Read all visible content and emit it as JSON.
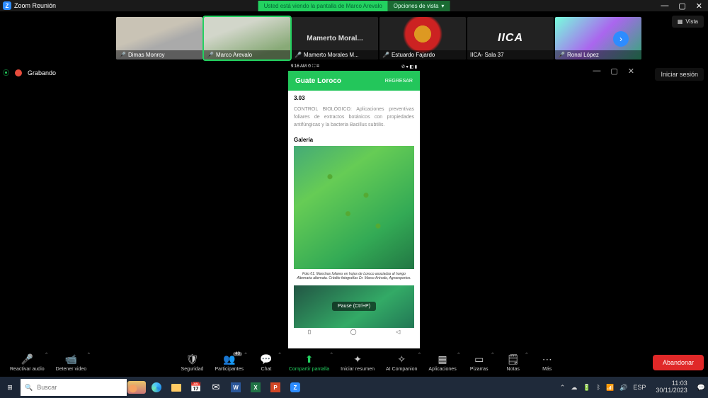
{
  "window": {
    "title": "Zoom Reunión"
  },
  "share_banner": {
    "message": "Usted está viendo la pantalla de Marco Arevalo",
    "options_label": "Opciones de vista"
  },
  "view_button": "Vista",
  "participants_strip": [
    {
      "name": "Dimas Monroy",
      "muted": true,
      "type": "cam",
      "cam": "c1"
    },
    {
      "name": "Marco Arevalo",
      "muted": true,
      "type": "cam",
      "cam": "c2",
      "speaking": true
    },
    {
      "name": "Mamerto Morales M...",
      "muted": true,
      "type": "placeholder",
      "placeholder_text": "Mamerto Moral..."
    },
    {
      "name": "Estuardo Fajardo",
      "muted": true,
      "type": "cam",
      "cam": "c4"
    },
    {
      "name": "IICA- Sala 37",
      "muted": false,
      "type": "logo",
      "logo": "IICA"
    },
    {
      "name": "Ronal López",
      "muted": true,
      "type": "cam",
      "cam": "c6"
    }
  ],
  "recording": {
    "label": "Grabando"
  },
  "signin": "Iniciar sesión",
  "phone": {
    "status_left": "9:16 AM ⏱ ⛶ ✉",
    "status_right": "✆ ▾ ◧ ▮",
    "app_title": "Guate Loroco",
    "back_btn": "REGRESAR",
    "code": "3.03",
    "body_text": "CONTROL BIOLÓGICO: Aplicaciones preventivas foliares de extractos botánicos con propiedades antifúngicas y la bacteria Bacillus subtilis.",
    "gallery_label": "Galería",
    "caption": "Foto 01. Manchas foliares en hojas de Loroco asociadas al hongo Alternaria alternata. Crédito fotografías Dr. Marco Arévalo, Agroexpertos.",
    "pause_tip": "Pause (Ctrl+P)"
  },
  "toolbar": {
    "audio": "Reactivar audio",
    "video": "Detener video",
    "security": "Seguridad",
    "participants": "Participantes",
    "participants_count": "40",
    "chat": "Chat",
    "share": "Compartir pantalla",
    "summary": "Iniciar resumen",
    "ai": "AI Companion",
    "apps": "Aplicaciones",
    "whiteboard": "Pizarras",
    "notes": "Notas",
    "more": "Más",
    "leave": "Abandonar"
  },
  "taskbar": {
    "search_placeholder": "Buscar",
    "lang": "ESP",
    "time": "11:03",
    "date": "30/11/2023"
  }
}
